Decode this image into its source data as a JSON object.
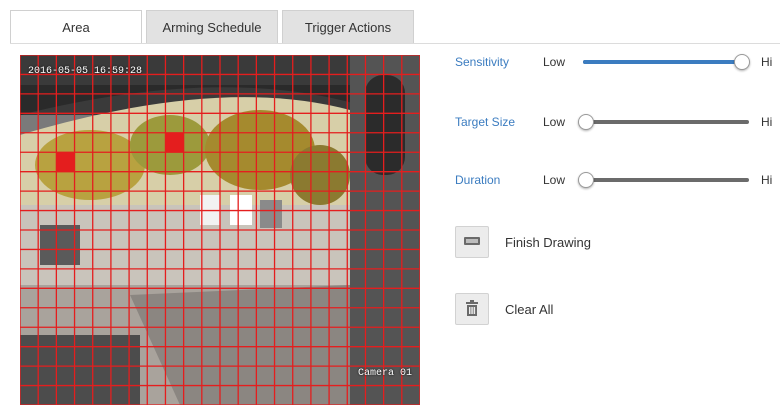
{
  "tabs": [
    "Area",
    "Arming Schedule",
    "Trigger Actions"
  ],
  "video": {
    "osd_top": "2016-05-05 16:59:28",
    "osd_bottom": "Camera 01"
  },
  "sliders": [
    {
      "label": "Sensitivity",
      "low": "Low",
      "high": "Hi",
      "level": 0.96
    },
    {
      "label": "Target Size",
      "low": "Low",
      "high": "Hi",
      "level": 0.02
    },
    {
      "label": "Duration",
      "low": "Low",
      "high": "Hi",
      "level": 0.02
    }
  ],
  "actions": {
    "finish_drawing": "Finish Drawing",
    "clear_all": "Clear All"
  },
  "colors": {
    "grid": "#e41e1e",
    "accent": "#3b7cc0"
  }
}
